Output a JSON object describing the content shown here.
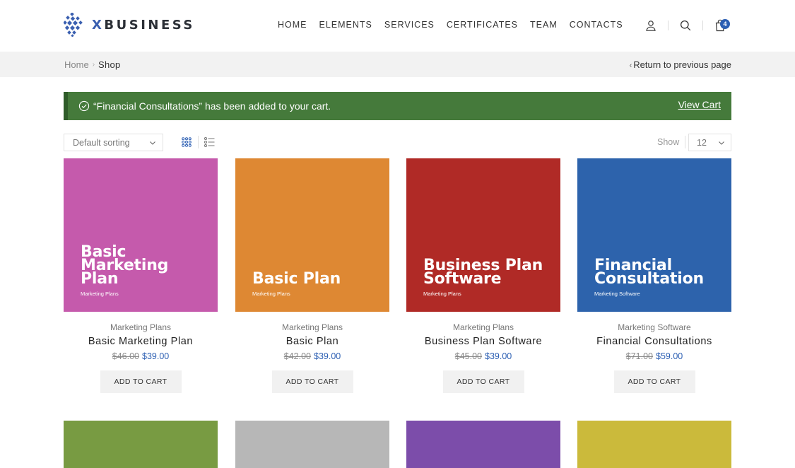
{
  "brand": {
    "x": "X",
    "name": "BUSINESS"
  },
  "nav": [
    "HOME",
    "ELEMENTS",
    "SERVICES",
    "CERTIFICATES",
    "TEAM",
    "CONTACTS"
  ],
  "cart_count": "4",
  "breadcrumb": {
    "home": "Home",
    "sep": "›",
    "current": "Shop"
  },
  "back_link": {
    "chevron": "‹",
    "label": "Return to previous page"
  },
  "notice": {
    "text": "“Financial Consultations” has been added to your cart.",
    "link": "View Cart",
    "bg_color": "#457a3b"
  },
  "toolbar": {
    "sorting": "Default sorting",
    "show_label": "Show",
    "show_value": "12"
  },
  "products": [
    {
      "title1": "Basic Marketing",
      "title2": "Plan",
      "img_sub": "Marketing Plans",
      "category": "Marketing Plans",
      "name": "Basic Marketing Plan",
      "old_price": "$46.00",
      "price": "$39.00",
      "button": "ADD TO CART",
      "color": "#c55aac"
    },
    {
      "title1": "",
      "title2": "Basic Plan",
      "img_sub": "Marketing Plans",
      "category": "Marketing Plans",
      "name": "Basic Plan",
      "old_price": "$42.00",
      "price": "$39.00",
      "button": "ADD TO CART",
      "color": "#de8833"
    },
    {
      "title1": "Business Plan",
      "title2": "Software",
      "img_sub": "Marketing Plans",
      "category": "Marketing Plans",
      "name": "Business Plan Software",
      "old_price": "$45.00",
      "price": "$39.00",
      "button": "ADD TO CART",
      "color": "#b02a26"
    },
    {
      "title1": "Financial",
      "title2": "Consultation",
      "img_sub": "Marketing Software",
      "category": "Marketing Software",
      "name": "Financial Consultations",
      "old_price": "$71.00",
      "price": "$59.00",
      "button": "ADD TO CART",
      "color": "#2d63ac"
    }
  ],
  "row2_colors": [
    "#789b42",
    "#b7b7b7",
    "#7c4daa",
    "#cbba3b"
  ],
  "accent_color": "#2c5fb3"
}
